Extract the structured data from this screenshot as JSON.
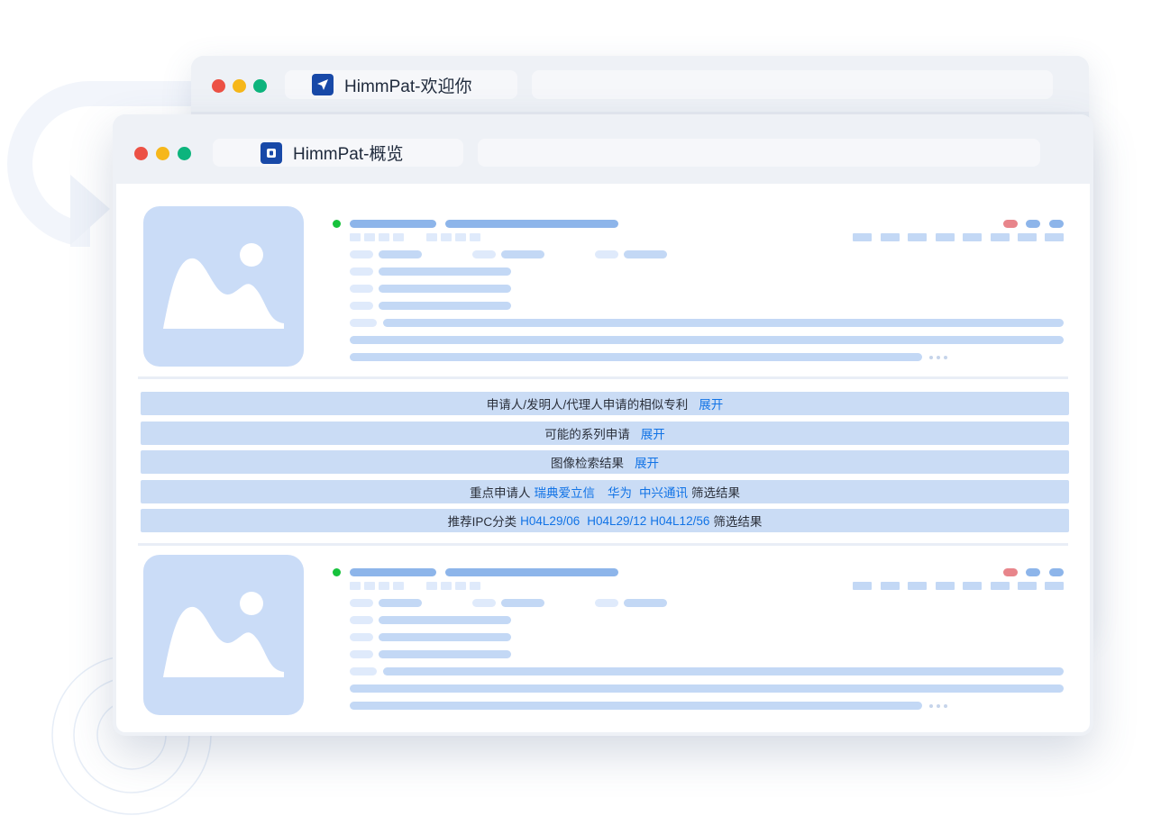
{
  "back_window": {
    "tab_title": "HimmPat-欢迎你",
    "tab_icon": "send-arrow-icon"
  },
  "front_window": {
    "tab_title": "HimmPat-概览",
    "tab_icon": "himmpat-logo-icon"
  },
  "panels": {
    "similar": {
      "text": "申请人/发明人/代理人申请的相似专利",
      "action": "展开"
    },
    "family": {
      "text": "可能的系列申请",
      "action": "展开"
    },
    "image_search": {
      "text": "图像检索结果",
      "action": "展开"
    },
    "key_applicants": {
      "prefix": "重点申请人",
      "applicants": [
        "瑞典爱立信",
        "华为",
        "中兴通讯"
      ],
      "suffix": "筛选结果"
    },
    "ipc": {
      "prefix": "推荐IPC分类",
      "codes": [
        "H04L29/06",
        "H04L29/12",
        "H04L12/56"
      ],
      "suffix": "筛选结果"
    }
  },
  "colors": {
    "accent_link": "#1173e6",
    "panel_bg": "#cadcf5",
    "thumb_bg": "#cadcf7",
    "status_green": "#17c23c",
    "traffic_red": "#ec5145",
    "traffic_yellow": "#f6b71a",
    "traffic_green": "#0db47d"
  }
}
